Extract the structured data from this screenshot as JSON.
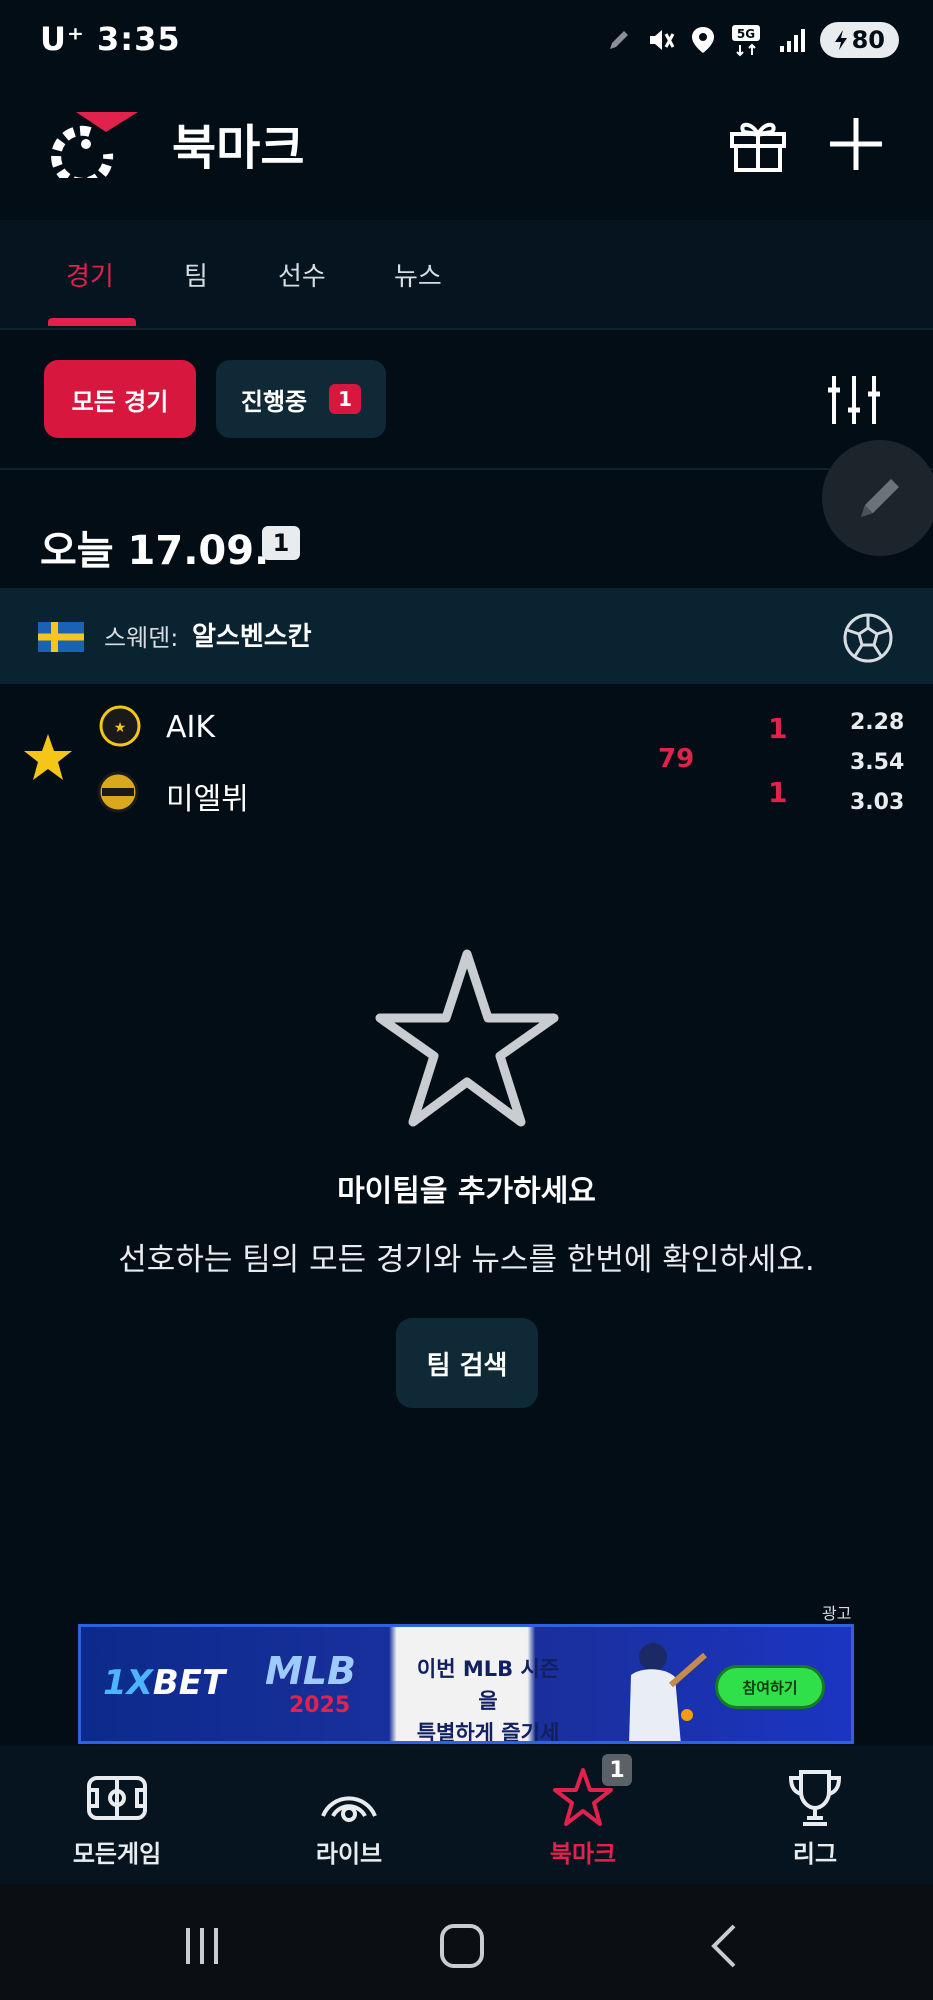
{
  "status_bar": {
    "carrier_time": "U⁺ 3:35",
    "network": "5G",
    "battery": "80"
  },
  "header": {
    "title": "북마크"
  },
  "tabs": [
    {
      "label": "경기",
      "active": true
    },
    {
      "label": "팀",
      "active": false
    },
    {
      "label": "선수",
      "active": false
    },
    {
      "label": "뉴스",
      "active": false
    }
  ],
  "filters": {
    "all_label": "모든 경기",
    "live_label": "진행중",
    "live_count": "1"
  },
  "date_section": {
    "label": "오늘 17.09.",
    "count": "1"
  },
  "league": {
    "country": "스웨덴:",
    "name": "알스벤스칸"
  },
  "match": {
    "home_team": "AIK",
    "away_team": "미엘뷔",
    "minute": "79",
    "home_score": "1",
    "away_score": "1",
    "odds": [
      "2.28",
      "3.54",
      "3.03"
    ]
  },
  "empty_state": {
    "title": "마이팀을 추가하세요",
    "description": "선호하는 팀의 모든 경기와 뉴스를 한번에 확인하세요.",
    "button_label": "팀 검색"
  },
  "ad": {
    "label": "광고",
    "brand_prefix": "1X",
    "brand_suffix": "BET",
    "league_logo": "MLB",
    "year": "2025",
    "text_line1": "이번 MLB 시즌을",
    "text_line2": "특별하게 즐기세요",
    "cta": "참여하기"
  },
  "bottom_nav": [
    {
      "label": "모든게임",
      "icon": "field-icon",
      "active": false
    },
    {
      "label": "라이브",
      "icon": "live-signal-icon",
      "active": false
    },
    {
      "label": "북마크",
      "icon": "star-icon",
      "active": true,
      "badge": "1"
    },
    {
      "label": "리그",
      "icon": "trophy-icon",
      "active": false
    }
  ],
  "colors": {
    "background": "#030d16",
    "accent": "#e0224d",
    "surface": "#0f2a36",
    "star": "#f5c518"
  }
}
